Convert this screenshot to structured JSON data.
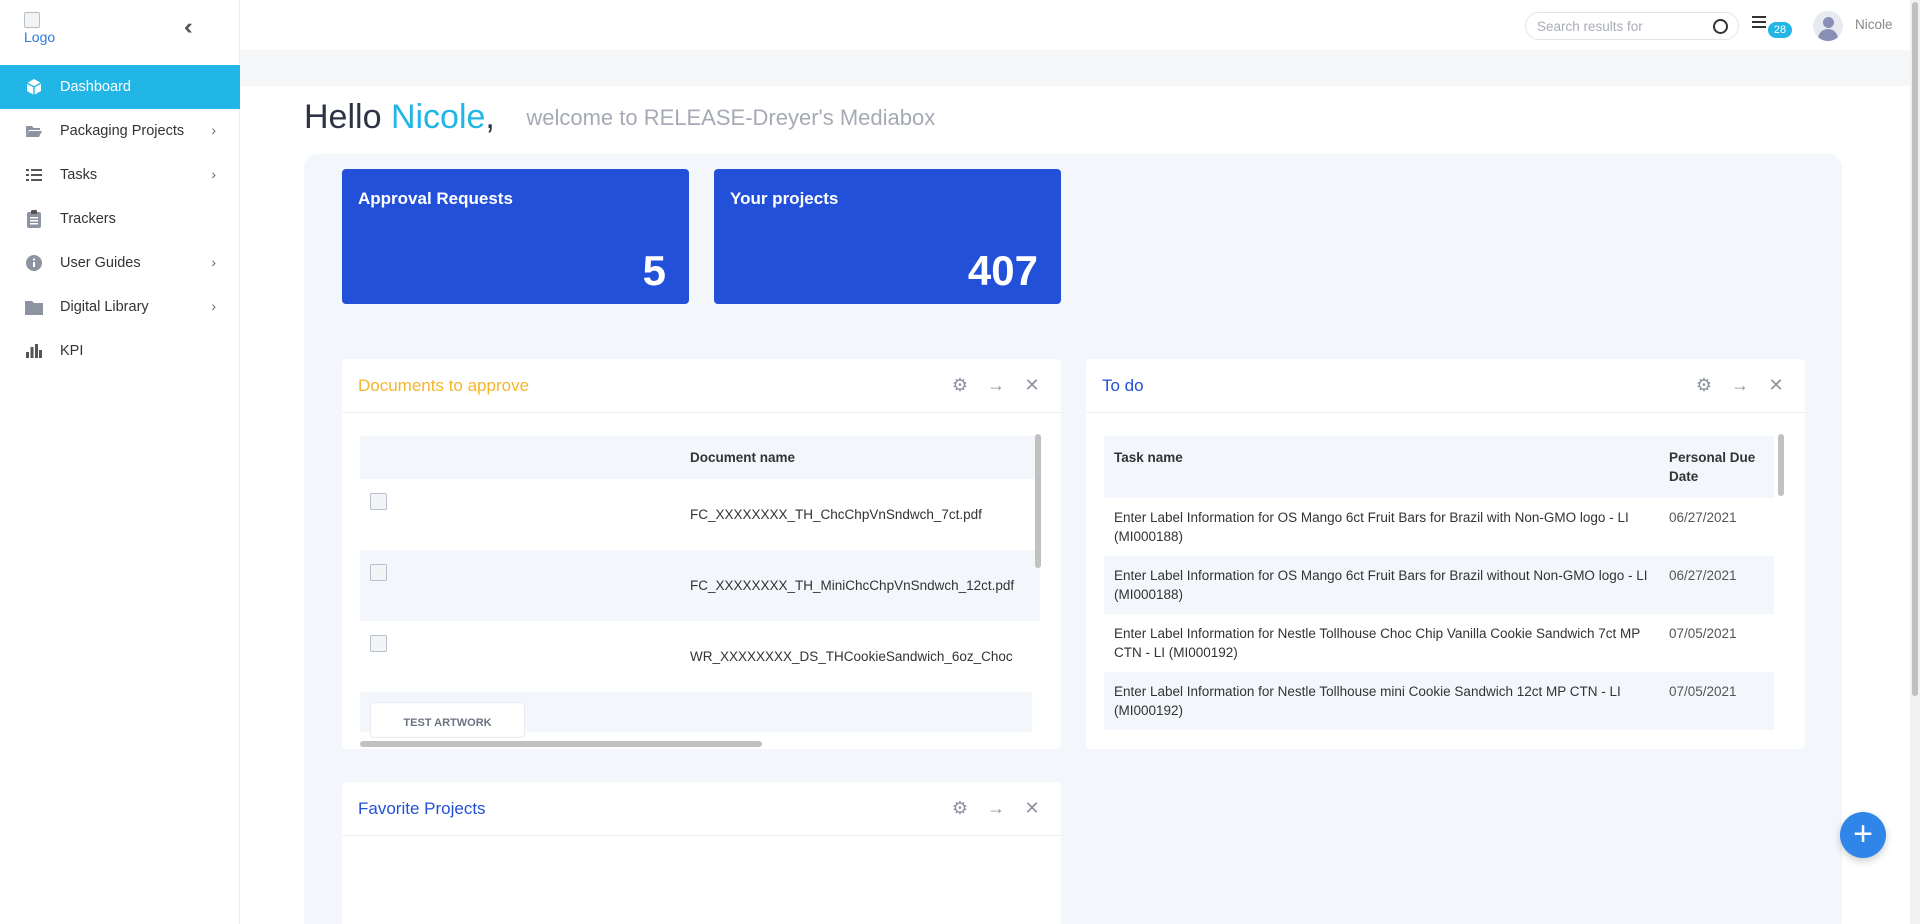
{
  "header": {
    "logo_alt": "Logo",
    "search_placeholder": "Search results for",
    "tasks_badge": "28",
    "username": "Nicole"
  },
  "sidebar": {
    "items": [
      {
        "label": "Dashboard",
        "icon": "cube-icon",
        "active": true,
        "has_submenu": false
      },
      {
        "label": "Packaging Projects",
        "icon": "folder-open-icon",
        "active": false,
        "has_submenu": true
      },
      {
        "label": "Tasks",
        "icon": "list-icon",
        "active": false,
        "has_submenu": true
      },
      {
        "label": "Trackers",
        "icon": "clipboard-icon",
        "active": false,
        "has_submenu": false
      },
      {
        "label": "User Guides",
        "icon": "info-icon",
        "active": false,
        "has_submenu": true
      },
      {
        "label": "Digital Library",
        "icon": "folder-icon",
        "active": false,
        "has_submenu": true
      },
      {
        "label": "KPI",
        "icon": "bar-chart-icon",
        "active": false,
        "has_submenu": false
      }
    ]
  },
  "greeting": {
    "hello": "Hello",
    "name": "Nicole",
    "comma": ",",
    "welcome": "welcome to RELEASE-Dreyer's Mediabox"
  },
  "kpis": [
    {
      "title": "Approval Requests",
      "value": "5"
    },
    {
      "title": "Your projects",
      "value": "407"
    }
  ],
  "documents_card": {
    "title": "Documents to approve",
    "title_color": "#f5b52b",
    "column_header": "Document name",
    "rows": [
      {
        "name": "FC_XXXXXXXX_TH_ChcChpVnSndwch_7ct.pdf"
      },
      {
        "name": "FC_XXXXXXXX_TH_MiniChcChpVnSndwch_12ct.pdf"
      },
      {
        "name": "WR_XXXXXXXX_DS_THCookieSandwich_6oz_Choc"
      }
    ],
    "preview_label": "TEST ARTWORK"
  },
  "todo_card": {
    "title": "To do",
    "title_color": "#2250d8",
    "columns": [
      "Task name",
      "Personal Due Date"
    ],
    "rows": [
      {
        "task": "Enter Label Information for OS Mango 6ct Fruit Bars for Brazil with Non-GMO logo - LI (MI000188)",
        "date": "06/27/2021"
      },
      {
        "task": "Enter Label Information for OS Mango 6ct Fruit Bars for Brazil without Non-GMO logo - LI (MI000188)",
        "date": "06/27/2021"
      },
      {
        "task": "Enter Label Information for Nestle Tollhouse Choc Chip Vanilla Cookie Sandwich 7ct MP CTN - LI (MI000192)",
        "date": "07/05/2021"
      },
      {
        "task": "Enter Label Information for Nestle Tollhouse mini Cookie Sandwich 12ct MP CTN - LI (MI000192)",
        "date": "07/05/2021"
      }
    ]
  },
  "favorites_card": {
    "title": "Favorite Projects",
    "title_color": "#2250d8"
  },
  "colors": {
    "accent": "#21b6e6",
    "kpi_blue": "#2250d8",
    "fab_blue": "#2f86e8"
  }
}
